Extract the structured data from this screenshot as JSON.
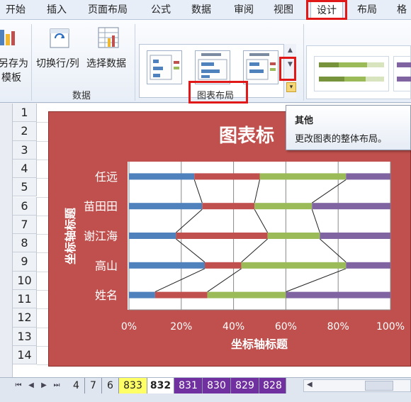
{
  "ribbon_tabs": [
    {
      "label": "开始",
      "active": false
    },
    {
      "label": "插入",
      "active": false
    },
    {
      "label": "页面布局",
      "active": false
    },
    {
      "label": "公式",
      "active": false
    },
    {
      "label": "数据",
      "active": false
    },
    {
      "label": "审阅",
      "active": false
    },
    {
      "label": "视图",
      "active": false
    },
    {
      "label": "设计",
      "active": true
    },
    {
      "label": "布局",
      "active": false
    },
    {
      "label": "格",
      "active": false
    }
  ],
  "ribbon": {
    "save_as_template": [
      "另存为",
      "模板"
    ],
    "switch_row_col": "切换行/列",
    "select_data": "选择数据",
    "data_group_label": "数据",
    "chart_layout_group_label": "图表布局"
  },
  "tooltip": {
    "title": "其他",
    "description": "更改图表的整体布局。"
  },
  "rows": [
    "1",
    "2",
    "3",
    "4",
    "5",
    "6",
    "7",
    "8",
    "9",
    "10",
    "11",
    "12",
    "13",
    "14"
  ],
  "sheet_tabs": [
    {
      "label": "4",
      "color": "#dfe6f0"
    },
    {
      "label": "7",
      "color": "#dfe6f0"
    },
    {
      "label": "6",
      "color": "#dfe6f0"
    },
    {
      "label": "833",
      "color": "#ffff66"
    },
    {
      "label": "832",
      "color": "#ffffff",
      "active": true
    },
    {
      "label": "831",
      "color": "#7030a0"
    },
    {
      "label": "830",
      "color": "#7030a0"
    },
    {
      "label": "829",
      "color": "#7030a0"
    },
    {
      "label": "828",
      "color": "#7030a0"
    }
  ],
  "colors": {
    "chart_bg": "#c0504d",
    "seg1": "#4f81bd",
    "seg2": "#c0504d",
    "seg3": "#9bbb59",
    "seg4": "#8064a2",
    "highlight": "#e01818"
  },
  "chart_data": {
    "type": "bar",
    "orientation": "horizontal",
    "stacking": "percent",
    "title": "图表标",
    "xlabel": "坐标轴标题",
    "ylabel": "坐标轴标题",
    "categories": [
      "任远",
      "苗田田",
      "谢江海",
      "高山",
      "姓名"
    ],
    "xticks": [
      "0%",
      "20%",
      "40%",
      "60%",
      "80%",
      "100%"
    ],
    "xlim": [
      0,
      100
    ],
    "grid": true,
    "series_lines": true,
    "series": [
      {
        "values": [
          25,
          28,
          18,
          29,
          10
        ]
      },
      {
        "values": [
          25,
          20,
          35,
          14,
          20
        ]
      },
      {
        "values": [
          33,
          22,
          20,
          40,
          30
        ]
      },
      {
        "values": [
          17,
          30,
          27,
          17,
          40
        ]
      }
    ]
  }
}
